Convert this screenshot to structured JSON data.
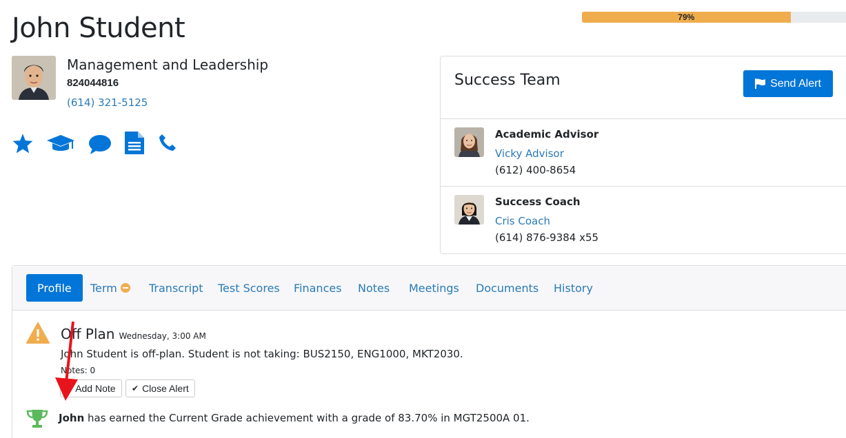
{
  "progress": {
    "percent": 79,
    "label": "79%",
    "color": "#f0ad4e"
  },
  "student": {
    "name": "John Student",
    "program": "Management and Leadership",
    "id": "824044816",
    "phone": "(614) 321-5125"
  },
  "quick_icons": [
    "star-icon",
    "graduation-cap-icon",
    "chat-bubble-icon",
    "document-icon",
    "phone-icon"
  ],
  "success_team": {
    "title": "Success Team",
    "send_alert_label": "Send Alert",
    "members": [
      {
        "role": "Academic Advisor",
        "name": "Vicky Advisor",
        "phone": "(612) 400-8654"
      },
      {
        "role": "Success Coach",
        "name": "Cris Coach",
        "phone": "(614) 876-9384 x55"
      }
    ]
  },
  "tabs": [
    {
      "label": "Profile",
      "active": true
    },
    {
      "label": "Term",
      "badge": "minus-circle-icon"
    },
    {
      "label": "Transcript"
    },
    {
      "label": "Test Scores"
    },
    {
      "label": "Finances"
    },
    {
      "label": "Notes"
    },
    {
      "label": "Meetings"
    },
    {
      "label": "Documents"
    },
    {
      "label": "History"
    }
  ],
  "alert": {
    "title": "Off Plan",
    "time": "Wednesday, 3:00 AM",
    "message": "John Student is off-plan. Student is not taking: BUS2150, ENG1000, MKT2030.",
    "notes": "Notes: 0",
    "add_note_label": "Add Note",
    "close_alert_label": "Close Alert"
  },
  "achievement": {
    "name": "John",
    "text": " has earned the Current Grade achievement with a grade of 83.70% in MGT2500A 01."
  },
  "colors": {
    "primary": "#0275d8",
    "link": "#2a7ab8",
    "warning": "#f0ad4e",
    "success": "#5cb85c",
    "annotation": "#e8141b"
  }
}
